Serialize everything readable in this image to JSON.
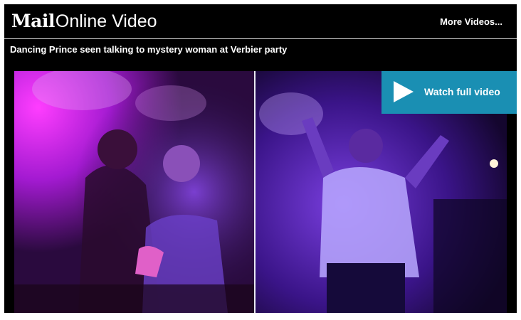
{
  "header": {
    "brand_mail": "Mail",
    "brand_online": "Online Video",
    "more_videos": "More Videos..."
  },
  "video": {
    "title": "Dancing Prince seen talking to mystery woman at Verbier party",
    "cta_label": "Watch full video"
  },
  "colors": {
    "background": "#000000",
    "cta": "#1a8fb3",
    "text": "#ffffff"
  },
  "icons": {
    "cta": "play-icon"
  }
}
